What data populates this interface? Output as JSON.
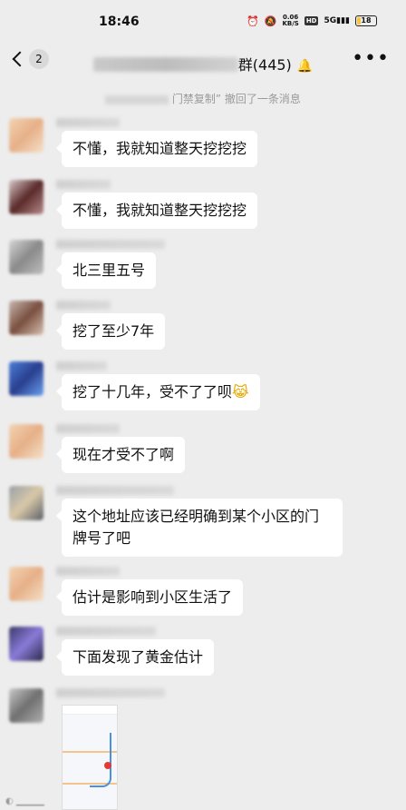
{
  "status_bar": {
    "time": "18:46",
    "net_speed_value": "0.06",
    "net_speed_unit": "KB/S",
    "hd_label": "HD",
    "signal_label": "5G",
    "battery": "18"
  },
  "header": {
    "back_unread_count": "2",
    "title_suffix": "群(445)"
  },
  "system_message": {
    "visible_text": "门禁复制” 撤回了一条消息"
  },
  "messages": [
    {
      "text": "不懂，我就知道整天挖挖挖"
    },
    {
      "text": "不懂，我就知道整天挖挖挖"
    },
    {
      "text": "北三里五号"
    },
    {
      "text": "挖了至少7年"
    },
    {
      "text": "挖了十几年，受不了了呗",
      "emoji": "😹"
    },
    {
      "text": "现在才受不了啊"
    },
    {
      "text": "这个地址应该已经明确到某个小区的门牌号了吧"
    },
    {
      "text": "估计是影响到小区生活了"
    },
    {
      "text": "下面发现了黄金估计"
    }
  ]
}
